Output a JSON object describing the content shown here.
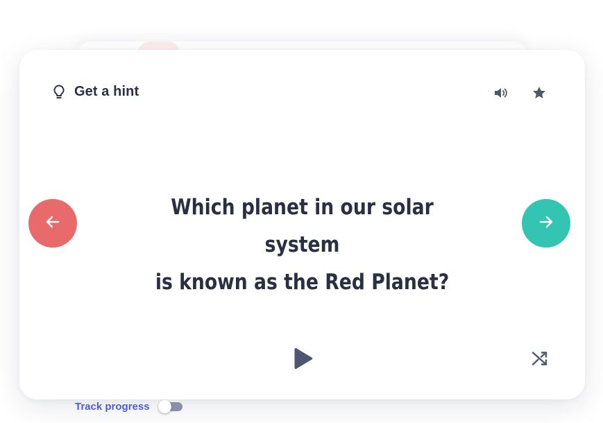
{
  "card": {
    "hint_label": "Get a hint",
    "question_line1": "Which planet in our solar system",
    "question_line2": "is known as the Red Planet?"
  },
  "icons": {
    "hint": "lightbulb-icon",
    "audio": "speaker-icon",
    "favorite": "star-icon",
    "previous": "arrow-left-icon",
    "next": "arrow-right-icon",
    "play": "play-icon",
    "shuffle": "shuffle-icon"
  },
  "footer": {
    "track_label": "Track progress",
    "track_enabled": false
  },
  "colors": {
    "text": "#2a3042",
    "icon": "#4f5670",
    "prev_button": "#e96a6a",
    "next_button": "#33c4b2",
    "track_label": "#4c5bd8",
    "toggle_off": "#8a90a8"
  }
}
